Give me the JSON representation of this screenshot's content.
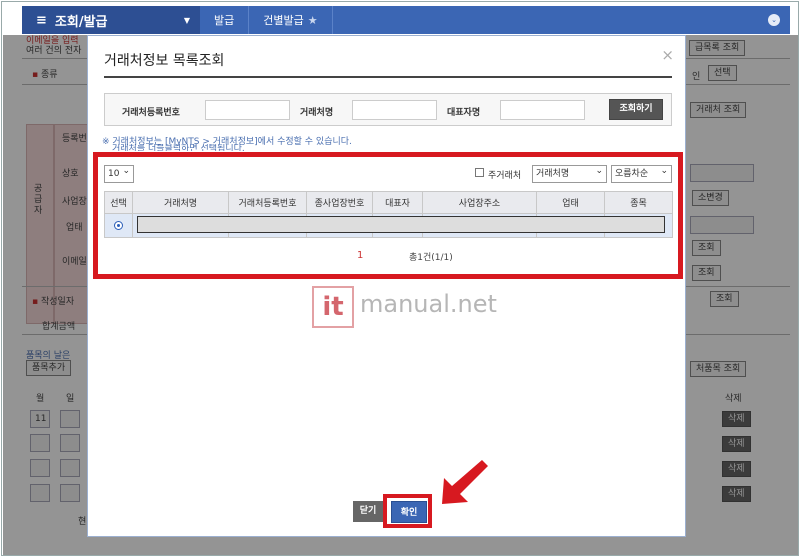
{
  "topnav": {
    "menu_title": "조회/발급",
    "crumbs": [
      "발급",
      "건별발급"
    ]
  },
  "background": {
    "line1": "이메일을 입력",
    "line2": "여러 건의 전자",
    "kind_label": "종류",
    "supplier_label": "공급자",
    "reg_label": "등록번호",
    "trade_label": "상호",
    "biz_label": "사업장",
    "type_label": "업태",
    "email_label": "이메일",
    "date_label": "작성일자",
    "sum_label": "합계금액",
    "items_note": "품목의 날은",
    "add_item": "품목추가",
    "month": "월",
    "day": "일",
    "month_val": "11",
    "right_btn1": "거래처목록 조회",
    "right_btn1_cut": "급목록 조회",
    "right_select": "선택",
    "right_in": "인",
    "right_btn2": "거래처 조회",
    "right_btn_change": "소변경",
    "right_query": "조회",
    "right_items": "처품목 조회",
    "delete": "삭제",
    "bottom_label": "현"
  },
  "modal": {
    "title": "거래처정보 목록조회",
    "close_glyph": "×",
    "search": {
      "reg_no_label": "거래처등록번호",
      "name_label": "거래처명",
      "rep_label": "대표자명",
      "button": "조회하기"
    },
    "notice": "※ 거래처정보는 [MyNTS > 거래처정보]에서 수정할 수 있습니다.",
    "notice2": "거래처를 더블클릭하면 선택됩니다.",
    "page_size": "10",
    "main_partner_label": "주거래처",
    "sort_field": "거래처명",
    "sort_order": "오름차순",
    "columns": [
      "선택",
      "거래처명",
      "거래처등록번호",
      "종사업장번호",
      "대표자",
      "사업장주소",
      "업태",
      "종목"
    ],
    "page": "1",
    "total": "총1건(1/1)",
    "close_button": "닫기",
    "ok_button": "확인"
  },
  "watermark": {
    "it": "it",
    "text": "manual.net"
  },
  "colors": {
    "nav_blue": "#3b66b4",
    "highlight_red": "#d71920",
    "row_selected": "#dfe8f6"
  }
}
